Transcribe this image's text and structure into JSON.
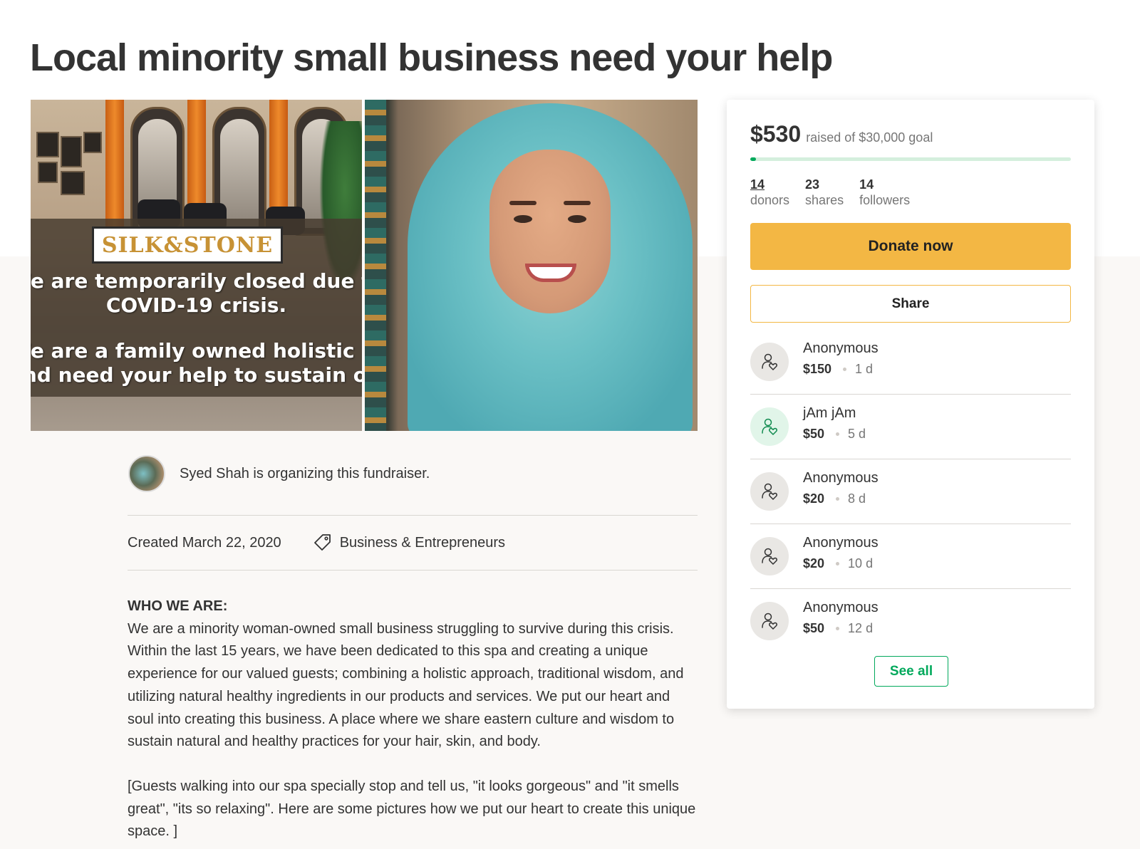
{
  "page": {
    "title": "Local minority small business need your help"
  },
  "hero": {
    "left_image": {
      "logo_text": "SILK&STONE",
      "lines": [
        "We are temporarily closed due to",
        "COVID-19 crisis.",
        "We are a family owned holistic day spa",
        "and need your help to sustain our business"
      ]
    }
  },
  "organizer": {
    "text": "Syed Shah is organizing this fundraiser."
  },
  "meta": {
    "created": "Created March 22, 2020",
    "category": "Business & Entrepreneurs",
    "category_icon": "tag-icon"
  },
  "story": {
    "heading": "WHO WE ARE:",
    "paragraph1": "We are a minority woman-owned small business struggling to survive during this crisis. Within the last 15 years, we have been dedicated to this spa and creating a unique experience for our valued guests; combining a holistic approach, traditional wisdom, and utilizing natural healthy ingredients in our products and services. We put our heart and soul into creating this business.  A place where we share eastern culture and wisdom to sustain natural and healthy practices for your hair, skin, and body.",
    "paragraph2": "[Guests walking into our spa specially stop and tell us, \"it looks gorgeous\" and \"it smells great\", \"its so relaxing\". Here are some pictures how we put our heart to create this unique space. ]"
  },
  "sidebar": {
    "raised_amount": "$530",
    "goal_text": "raised of $30,000 goal",
    "progress_fraction": 0.0177,
    "stats": [
      {
        "value": "14",
        "label": "donors"
      },
      {
        "value": "23",
        "label": "shares"
      },
      {
        "value": "14",
        "label": "followers"
      }
    ],
    "donate_label": "Donate now",
    "share_label": "Share",
    "donations": [
      {
        "name": "Anonymous",
        "amount": "$150",
        "time": "1 d",
        "icon": "donor-heart-icon"
      },
      {
        "name": "jAm jAm",
        "amount": "$50",
        "time": "5 d",
        "icon": "donor-heart-icon"
      },
      {
        "name": "Anonymous",
        "amount": "$20",
        "time": "8 d",
        "icon": "donor-heart-icon"
      },
      {
        "name": "Anonymous",
        "amount": "$20",
        "time": "10 d",
        "icon": "donor-heart-icon"
      },
      {
        "name": "Anonymous",
        "amount": "$50",
        "time": "12 d",
        "icon": "donor-heart-icon"
      }
    ],
    "see_all_label": "See all"
  },
  "colors": {
    "donate_yellow": "#f3b744",
    "progress_green": "#02a95c",
    "see_all_green": "#02a95c"
  }
}
